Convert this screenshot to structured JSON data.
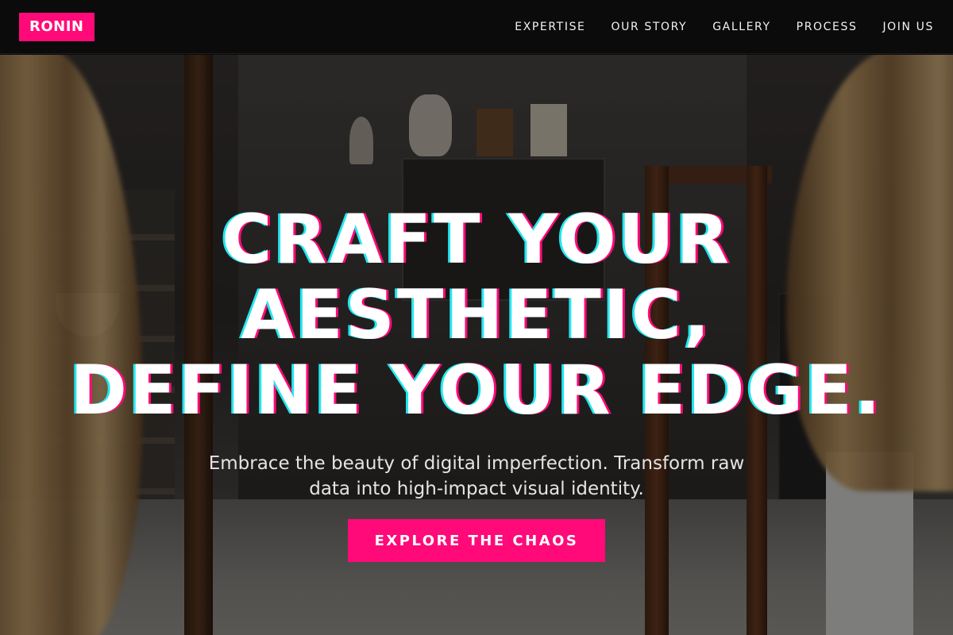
{
  "brand": {
    "logo_text": "RONIN",
    "accent_color": "#ff0a78",
    "glitch_color": "#23e6f0"
  },
  "nav": {
    "links": [
      {
        "label": "EXPERTISE"
      },
      {
        "label": "OUR STORY"
      },
      {
        "label": "GALLERY"
      },
      {
        "label": "PROCESS"
      },
      {
        "label": "JOIN US"
      }
    ]
  },
  "hero": {
    "headline_lines": [
      "CRAFT YOUR",
      "AESTHETIC,",
      "DEFINE YOUR EDGE."
    ],
    "subtitle": "Embrace the beauty of digital imperfection. Transform raw data into high-impact visual identity.",
    "cta_label": "EXPLORE THE CHAOS",
    "background_description_icon": "art-studio-photo"
  }
}
